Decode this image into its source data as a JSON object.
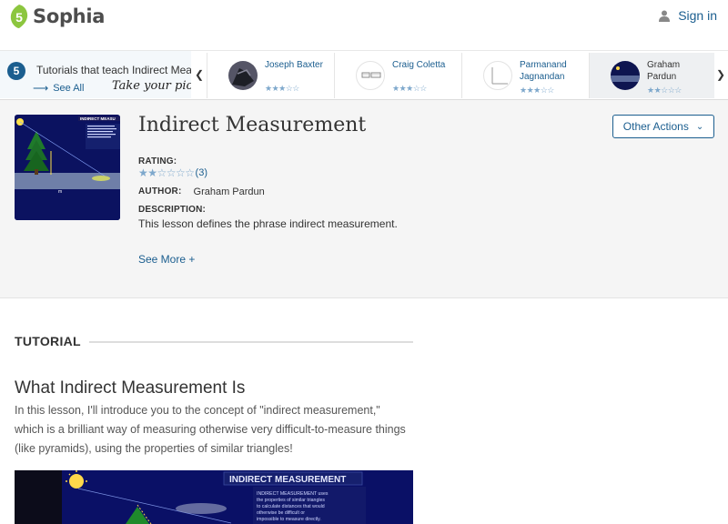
{
  "header": {
    "logo_text": "Sophia",
    "signin_label": "Sign in"
  },
  "strip": {
    "count": "5",
    "title": "Tutorials that teach Indirect Measurement",
    "see_all": "See All",
    "take_pick": "Take your pick:",
    "cards": [
      {
        "name": "Joseph Baxter",
        "stars": "★★★☆☆"
      },
      {
        "name": "Craig Coletta",
        "stars": "★★★☆☆"
      },
      {
        "name": "Parmanand Jagnandan",
        "stars": "★★★☆☆"
      },
      {
        "name": "Graham Pardun",
        "stars": "★★☆☆☆"
      }
    ]
  },
  "lesson": {
    "title": "Indirect Measurement",
    "rating_label": "RATING:",
    "rating_stars": "★★☆☆☆☆",
    "rating_count": "(3)",
    "author_label": "AUTHOR:",
    "author_name": "Graham Pardun",
    "description_label": "DESCRIPTION:",
    "description": "This lesson defines the phrase indirect measurement.",
    "see_more": "See More +",
    "other_actions": "Other Actions"
  },
  "tutorial": {
    "section_label": "TUTORIAL",
    "title": "What Indirect Measurement Is",
    "body": "In this lesson, I'll introduce you to the concept of \"indirect measurement,\" which is a brilliant way of measuring otherwise very difficult-to-measure things (like pyramids), using the properties of similar triangles!",
    "video_heading": "INDIRECT MEASUREMENT",
    "video_caption": "INDIRECT MEASUREMENT uses the properties of similar triangles to calculate distances that would otherwise be difficult or impossible to measure directly."
  },
  "colors": {
    "brand_green": "#8cc63f",
    "link_blue": "#1b5e8f",
    "star_blue": "#7ea8cc",
    "panel_gray": "#f5f5f5"
  },
  "icons": [
    "sophia-logo-icon",
    "user-icon",
    "arrow-right-icon",
    "chevron-left-icon",
    "chevron-right-icon",
    "chevron-down-icon",
    "star-icon"
  ]
}
